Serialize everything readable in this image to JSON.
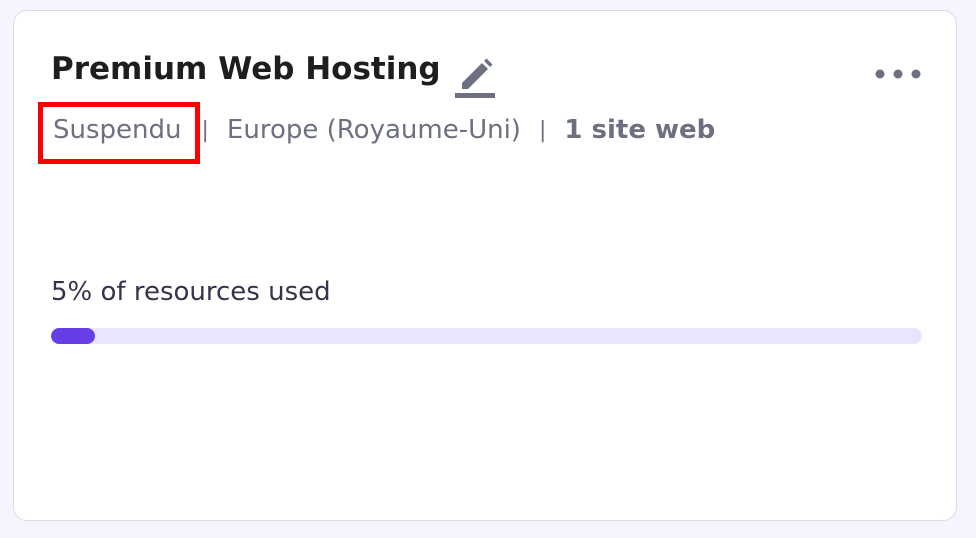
{
  "card": {
    "title": "Premium Web Hosting",
    "status": "Suspendu",
    "separator": "|",
    "region": "Europe (Royaume-Uni)",
    "websites": "1 site web",
    "usage_label": "5% of resources used",
    "usage_fraction": 0.05
  },
  "icons": {
    "edit": "pencil-edit-icon",
    "more": "more-horizontal-icon"
  },
  "colors": {
    "accent": "#673de6",
    "progress_track": "#ebe4ff",
    "highlight_box": "#ff0000",
    "title_text": "#1d1e20",
    "meta_text": "#6d7081"
  }
}
